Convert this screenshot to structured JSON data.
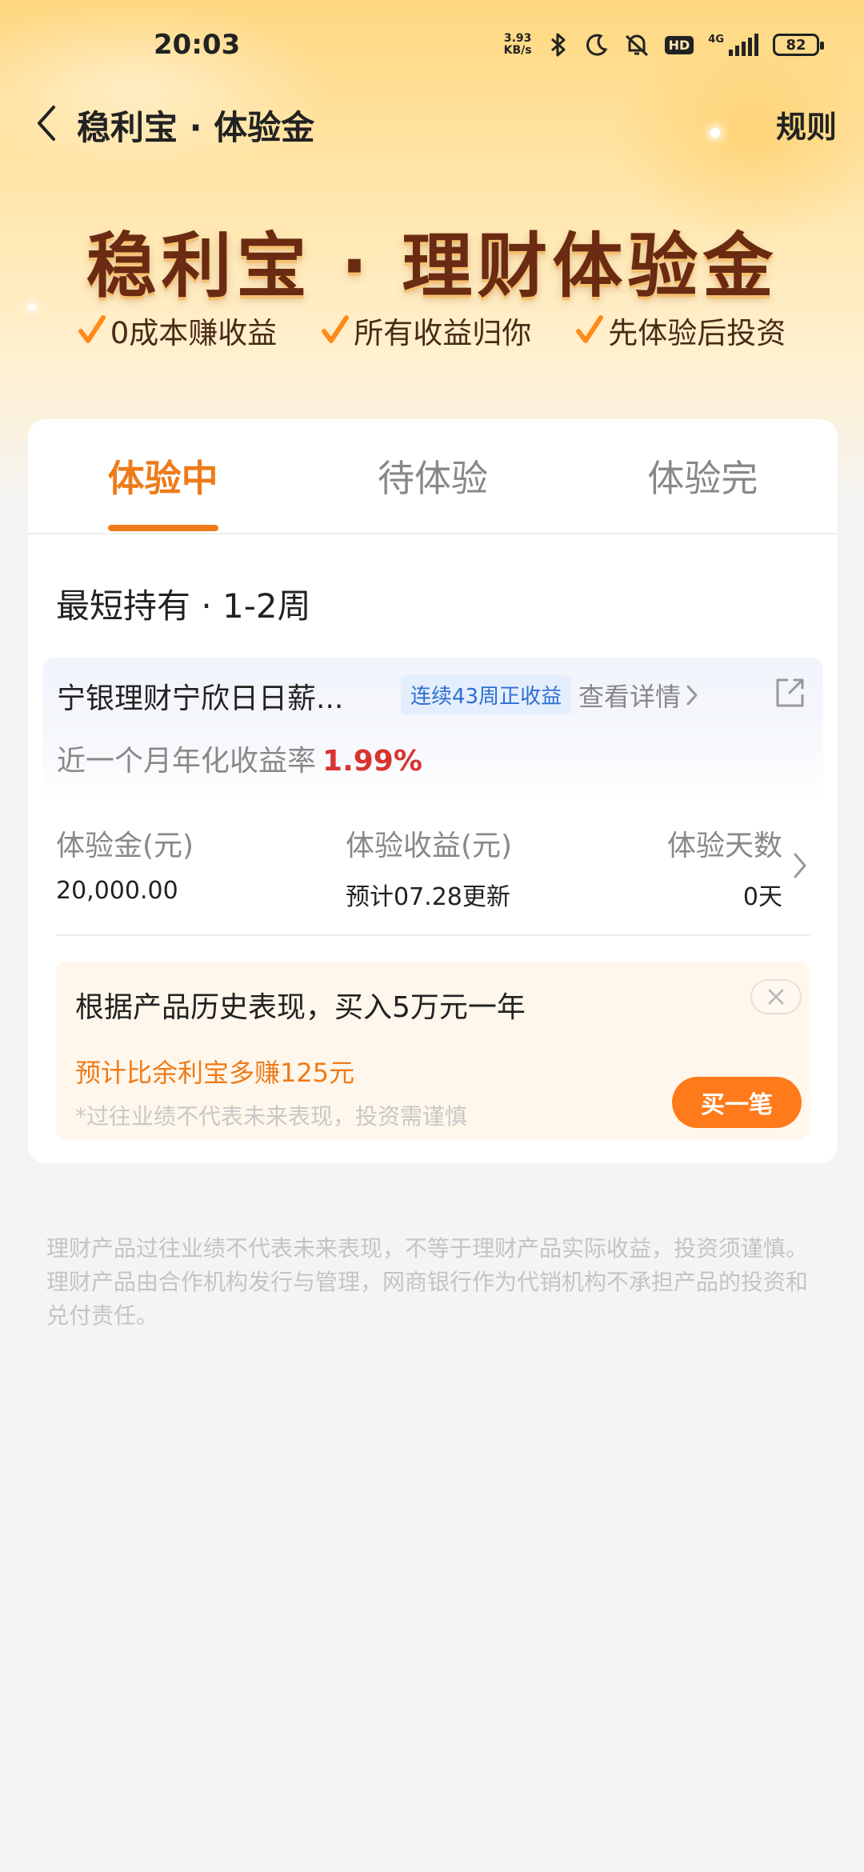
{
  "status_bar": {
    "time": "20:03",
    "net_speed_value": "3.93",
    "net_speed_unit": "KB/s",
    "hd_label": "HD",
    "network_label": "4G",
    "battery": "82"
  },
  "nav": {
    "title": "稳利宝 · 体验金",
    "rules": "规则"
  },
  "banner": {
    "title": "稳利宝 · 理财体验金",
    "features": [
      "0成本赚收益",
      "所有收益归你",
      "先体验后投资"
    ]
  },
  "tabs": [
    {
      "label": "体验中",
      "active": true
    },
    {
      "label": "待体验",
      "active": false
    },
    {
      "label": "体验完",
      "active": false
    }
  ],
  "holding": {
    "section_title": "最短持有 · 1-2周",
    "product_name": "宁银理财宁欣日日薪...",
    "streak_badge": "连续43周正收益",
    "detail_link": "查看详情",
    "yield_label": "近一个月年化收益率",
    "yield_value": "1.99%"
  },
  "stats": [
    {
      "label": "体验金(元)",
      "value": "20,000.00"
    },
    {
      "label": "体验收益(元)",
      "value": "预计07.28更新"
    },
    {
      "label": "体验天数",
      "value": "0天"
    }
  ],
  "promo": {
    "title": "根据产品历史表现，买入5万元一年",
    "highlight": "预计比余利宝多赚125元",
    "disclaimer": "*过往业绩不代表未来表现，投资需谨慎",
    "button": "买一笔"
  },
  "footer_note": "理财产品过往业绩不代表未来表现，不等于理财产品实际收益，投资须谨慎。理财产品由合作机构发行与管理，网商银行作为代销机构不承担产品的投资和兑付责任。",
  "colors": {
    "accent": "#ee7b1a",
    "button": "#ff7a1a",
    "yield": "#d9332f",
    "badge_text": "#2e6fd2",
    "banner_title": "#6a2b12"
  }
}
